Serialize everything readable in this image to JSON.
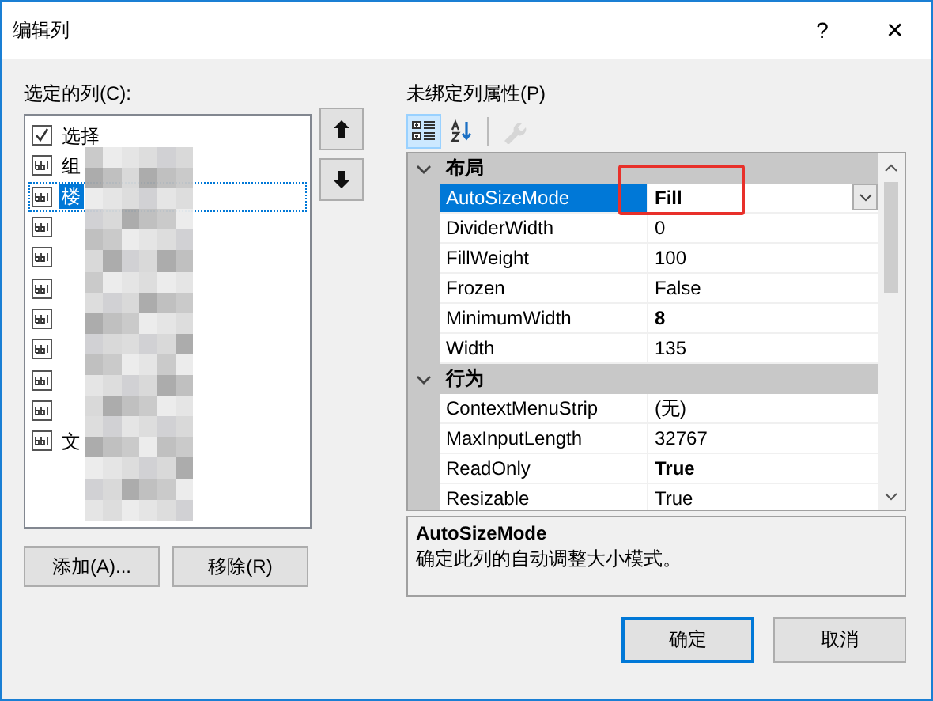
{
  "window": {
    "title": "编辑列",
    "help": "?",
    "close": "✕"
  },
  "columns_panel": {
    "label": "选定的列(C):",
    "items": [
      {
        "kind": "checkbox",
        "label": "选择",
        "selected": false
      },
      {
        "kind": "text",
        "label": "组",
        "selected": false
      },
      {
        "kind": "text",
        "label": "楼",
        "selected": true
      },
      {
        "kind": "text",
        "selected": false
      },
      {
        "kind": "text",
        "selected": false
      },
      {
        "kind": "text",
        "selected": false
      },
      {
        "kind": "text",
        "selected": false
      },
      {
        "kind": "text",
        "selected": false
      },
      {
        "kind": "text",
        "selected": false
      },
      {
        "kind": "text",
        "selected": false
      },
      {
        "kind": "text",
        "label": "文",
        "selected": false
      }
    ],
    "buttons": [
      "添加(A)...",
      "移除(R)"
    ]
  },
  "properties_panel": {
    "label": "未绑定列属性(P)",
    "toolbar": [
      {
        "kind": "categorized",
        "selected": true,
        "disabled": false
      },
      {
        "kind": "alphabetical",
        "selected": false,
        "disabled": false
      },
      {
        "kind": "property-pages",
        "selected": false,
        "disabled": true
      }
    ],
    "categories": [
      {
        "name": "布局",
        "expanded": true,
        "properties": [
          {
            "name": "AutoSizeMode",
            "value": "Fill",
            "bold": true,
            "selected": true
          },
          {
            "name": "DividerWidth",
            "value": "0",
            "bold": false,
            "selected": false
          },
          {
            "name": "FillWeight",
            "value": "100",
            "bold": false,
            "selected": false
          },
          {
            "name": "Frozen",
            "value": "False",
            "bold": false,
            "selected": false
          },
          {
            "name": "MinimumWidth",
            "value": "8",
            "bold": true,
            "selected": false
          },
          {
            "name": "Width",
            "value": "135",
            "bold": false,
            "selected": false
          }
        ]
      },
      {
        "name": "行为",
        "expanded": true,
        "properties": [
          {
            "name": "ContextMenuStrip",
            "value": "(无)",
            "bold": false,
            "selected": false
          },
          {
            "name": "MaxInputLength",
            "value": "32767",
            "bold": false,
            "selected": false
          },
          {
            "name": "ReadOnly",
            "value": "True",
            "bold": true,
            "selected": false
          },
          {
            "name": "Resizable",
            "value": "True",
            "bold": false,
            "selected": false
          }
        ]
      }
    ],
    "description": {
      "title": "AutoSizeMode",
      "text": "确定此列的自动调整大小模式。"
    }
  },
  "dialog_buttons": [
    {
      "label": "确定",
      "default": true
    },
    {
      "label": "取消",
      "default": false
    }
  ]
}
